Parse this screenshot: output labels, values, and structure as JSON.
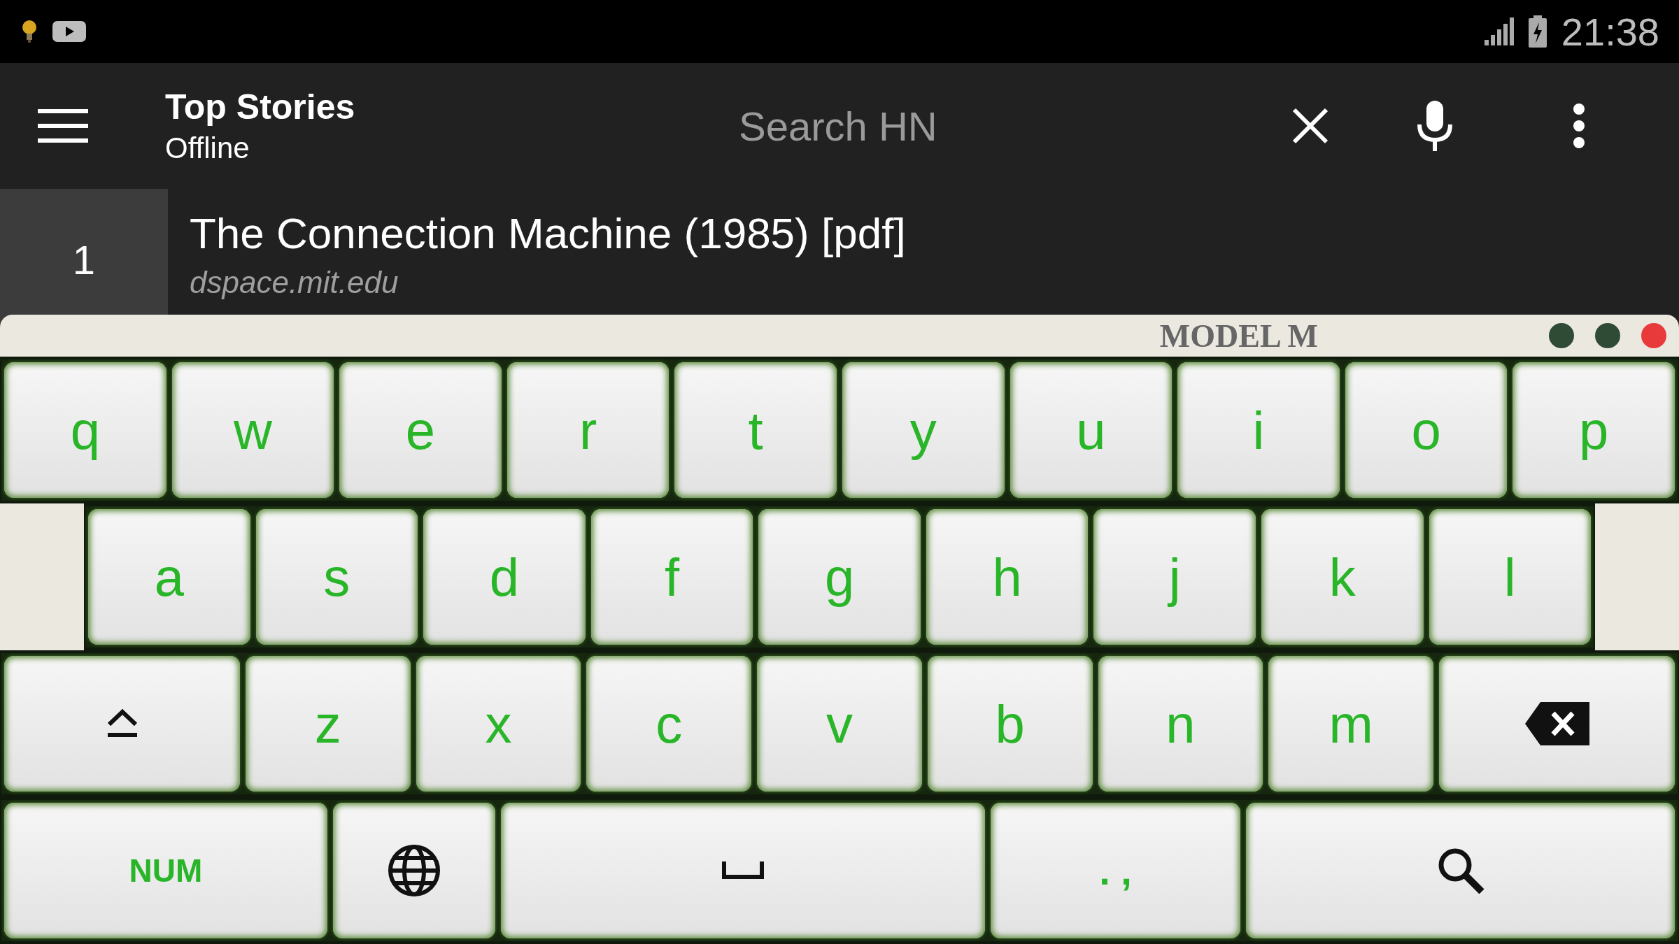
{
  "status_bar": {
    "time": "21:38"
  },
  "toolbar": {
    "title": "Top Stories",
    "subtitle": "Offline",
    "search": {
      "placeholder": "Search HN"
    }
  },
  "story": {
    "rank": "1",
    "title": "The Connection Machine (1985) [pdf]",
    "domain": "dspace.mit.edu"
  },
  "keyboard": {
    "title": "MODEL M",
    "window_dots": [
      {
        "color": "#2f4a35"
      },
      {
        "color": "#2f4a35"
      },
      {
        "color": "#e8393b"
      }
    ],
    "rows": [
      [
        {
          "kind": "char",
          "label": "q"
        },
        {
          "kind": "char",
          "label": "w"
        },
        {
          "kind": "char",
          "label": "e"
        },
        {
          "kind": "char",
          "label": "r"
        },
        {
          "kind": "char",
          "label": "t"
        },
        {
          "kind": "char",
          "label": "y"
        },
        {
          "kind": "char",
          "label": "u"
        },
        {
          "kind": "char",
          "label": "i"
        },
        {
          "kind": "char",
          "label": "o"
        },
        {
          "kind": "char",
          "label": "p"
        }
      ],
      [
        {
          "kind": "char",
          "label": "a"
        },
        {
          "kind": "char",
          "label": "s"
        },
        {
          "kind": "char",
          "label": "d"
        },
        {
          "kind": "char",
          "label": "f"
        },
        {
          "kind": "char",
          "label": "g"
        },
        {
          "kind": "char",
          "label": "h"
        },
        {
          "kind": "char",
          "label": "j"
        },
        {
          "kind": "char",
          "label": "k"
        },
        {
          "kind": "char",
          "label": "l"
        }
      ],
      [
        {
          "kind": "shift"
        },
        {
          "kind": "char",
          "label": "z"
        },
        {
          "kind": "char",
          "label": "x"
        },
        {
          "kind": "char",
          "label": "c"
        },
        {
          "kind": "char",
          "label": "v"
        },
        {
          "kind": "char",
          "label": "b"
        },
        {
          "kind": "char",
          "label": "n"
        },
        {
          "kind": "char",
          "label": "m"
        },
        {
          "kind": "backspace"
        }
      ],
      [
        {
          "kind": "num",
          "label": "NUM"
        },
        {
          "kind": "globe"
        },
        {
          "kind": "space"
        },
        {
          "kind": "punct",
          "label": ". ,"
        },
        {
          "kind": "search"
        }
      ]
    ]
  }
}
